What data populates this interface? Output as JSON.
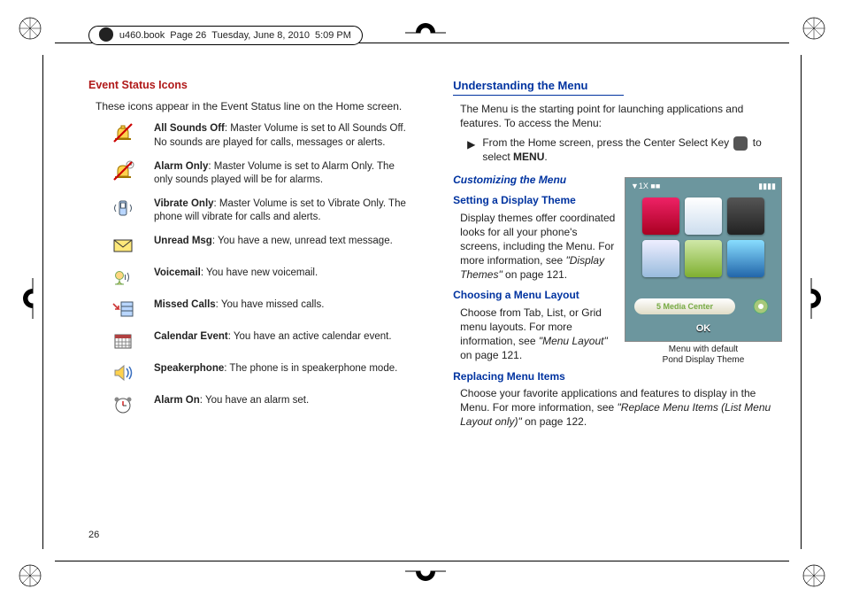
{
  "header": {
    "doc": "u460.book",
    "page": "Page 26",
    "date": "Tuesday, June 8, 2010",
    "time": "5:09 PM"
  },
  "left": {
    "heading": "Event Status Icons",
    "intro": "These icons appear in the Event Status line on the Home screen.",
    "items": [
      {
        "icon": "bell-mute-icon",
        "name": "All Sounds Off",
        "desc": ": Master Volume is set to All Sounds Off. No sounds are played for calls, messages or alerts."
      },
      {
        "icon": "alarm-only-icon",
        "name": "Alarm Only",
        "desc": ": Master Volume is set to  Alarm Only. The only sounds played will be for alarms."
      },
      {
        "icon": "vibrate-icon",
        "name": "Vibrate Only",
        "desc": ": Master Volume is set to Vibrate Only. The phone will vibrate for calls and alerts."
      },
      {
        "icon": "envelope-icon",
        "name": "Unread Msg",
        "desc": ": You have a new, unread text message."
      },
      {
        "icon": "voicemail-icon",
        "name": "Voicemail",
        "desc": ": You have new voicemail."
      },
      {
        "icon": "missed-call-icon",
        "name": "Missed Calls",
        "desc": ": You have missed calls."
      },
      {
        "icon": "calendar-icon",
        "name": "Calendar Event",
        "desc": ": You have an active calendar event."
      },
      {
        "icon": "speaker-icon",
        "name": "Speakerphone",
        "desc": ": The phone is in speakerphone mode."
      },
      {
        "icon": "alarm-on-icon",
        "name": "Alarm On",
        "desc": ": You have an alarm set."
      }
    ]
  },
  "right": {
    "heading": "Understanding the Menu",
    "intro": "The Menu is the starting point for launching applications and features. To access the Menu:",
    "step_pre": "From the Home screen, press the Center Select Key ",
    "step_post": " to select ",
    "step_menu": "MENU",
    "step_end": ".",
    "sub1": "Customizing the Menu",
    "h_theme": "Setting a Display Theme",
    "theme_p1": "Display themes offer coordinated looks for all your phone's screens, including the Menu. For more information, see ",
    "theme_ref": "\"Display Themes\"",
    "theme_p2": " on page 121.",
    "h_layout": "Choosing a Menu Layout",
    "layout_p1": "Choose from Tab, List, or Grid menu layouts. For more information, see ",
    "layout_ref": "\"Menu Layout\"",
    "layout_p2": " on page 121.",
    "h_replace": "Replacing Menu Items",
    "replace_p1": "Choose your favorite applications and features to display in the Menu. For more information, see ",
    "replace_ref": "\"Replace Menu Items (List Menu Layout only)\"",
    "replace_p2": " on page 122.",
    "figure": {
      "caption1": "Menu with default",
      "caption2": "Pond Display Theme",
      "pill": "5 Media Center",
      "ok": "OK",
      "status_left": "▼1X ■■",
      "status_right": "▮▮▮▮"
    }
  },
  "pagenum": "26"
}
